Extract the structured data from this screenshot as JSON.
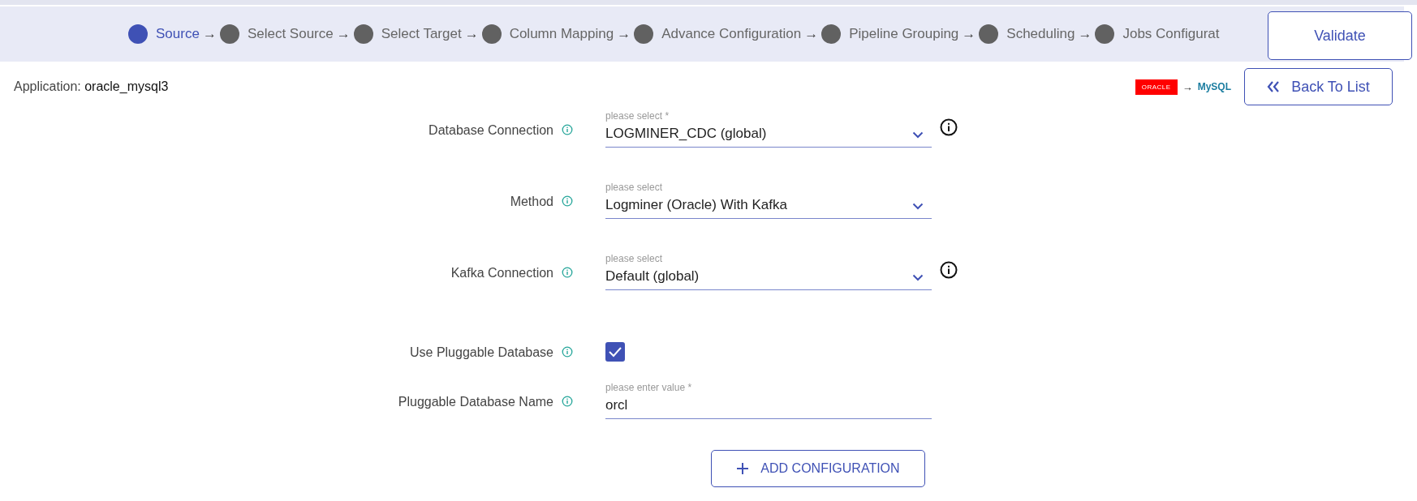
{
  "stepper": {
    "separator": "→",
    "steps": [
      {
        "label": "Source",
        "selected": true
      },
      {
        "label": "Select Source",
        "selected": false
      },
      {
        "label": "Select Target",
        "selected": false
      },
      {
        "label": "Column Mapping",
        "selected": false
      },
      {
        "label": "Advance Configuration",
        "selected": false
      },
      {
        "label": "Pipeline Grouping",
        "selected": false
      },
      {
        "label": "Scheduling",
        "selected": false
      },
      {
        "label": "Jobs Configurat",
        "selected": false
      }
    ]
  },
  "validate_button": "Validate",
  "application": {
    "label": "Application:",
    "value": "oracle_mysql3"
  },
  "flow": {
    "source_logo": "ORACLE",
    "arrow": "→",
    "target_logo": "MySQL"
  },
  "back_button": "Back To List",
  "form": [
    {
      "kind": "select",
      "label": "Database Connection",
      "placeholder": "please select *",
      "value": "LOGMINER_CDC (global)",
      "info_button": true
    },
    {
      "kind": "select",
      "label": "Method",
      "placeholder": "please select",
      "value": "Logminer (Oracle) With Kafka",
      "info_button": false
    },
    {
      "kind": "select",
      "label": "Kafka Connection",
      "placeholder": "please select",
      "value": "Default (global)",
      "info_button": true
    },
    {
      "kind": "checkbox",
      "label": "Use Pluggable Database",
      "checked": true
    },
    {
      "kind": "text",
      "label": "Pluggable Database Name",
      "placeholder": "please enter value *",
      "value": "orcl"
    }
  ],
  "add_button": "ADD CONFIGURATION"
}
